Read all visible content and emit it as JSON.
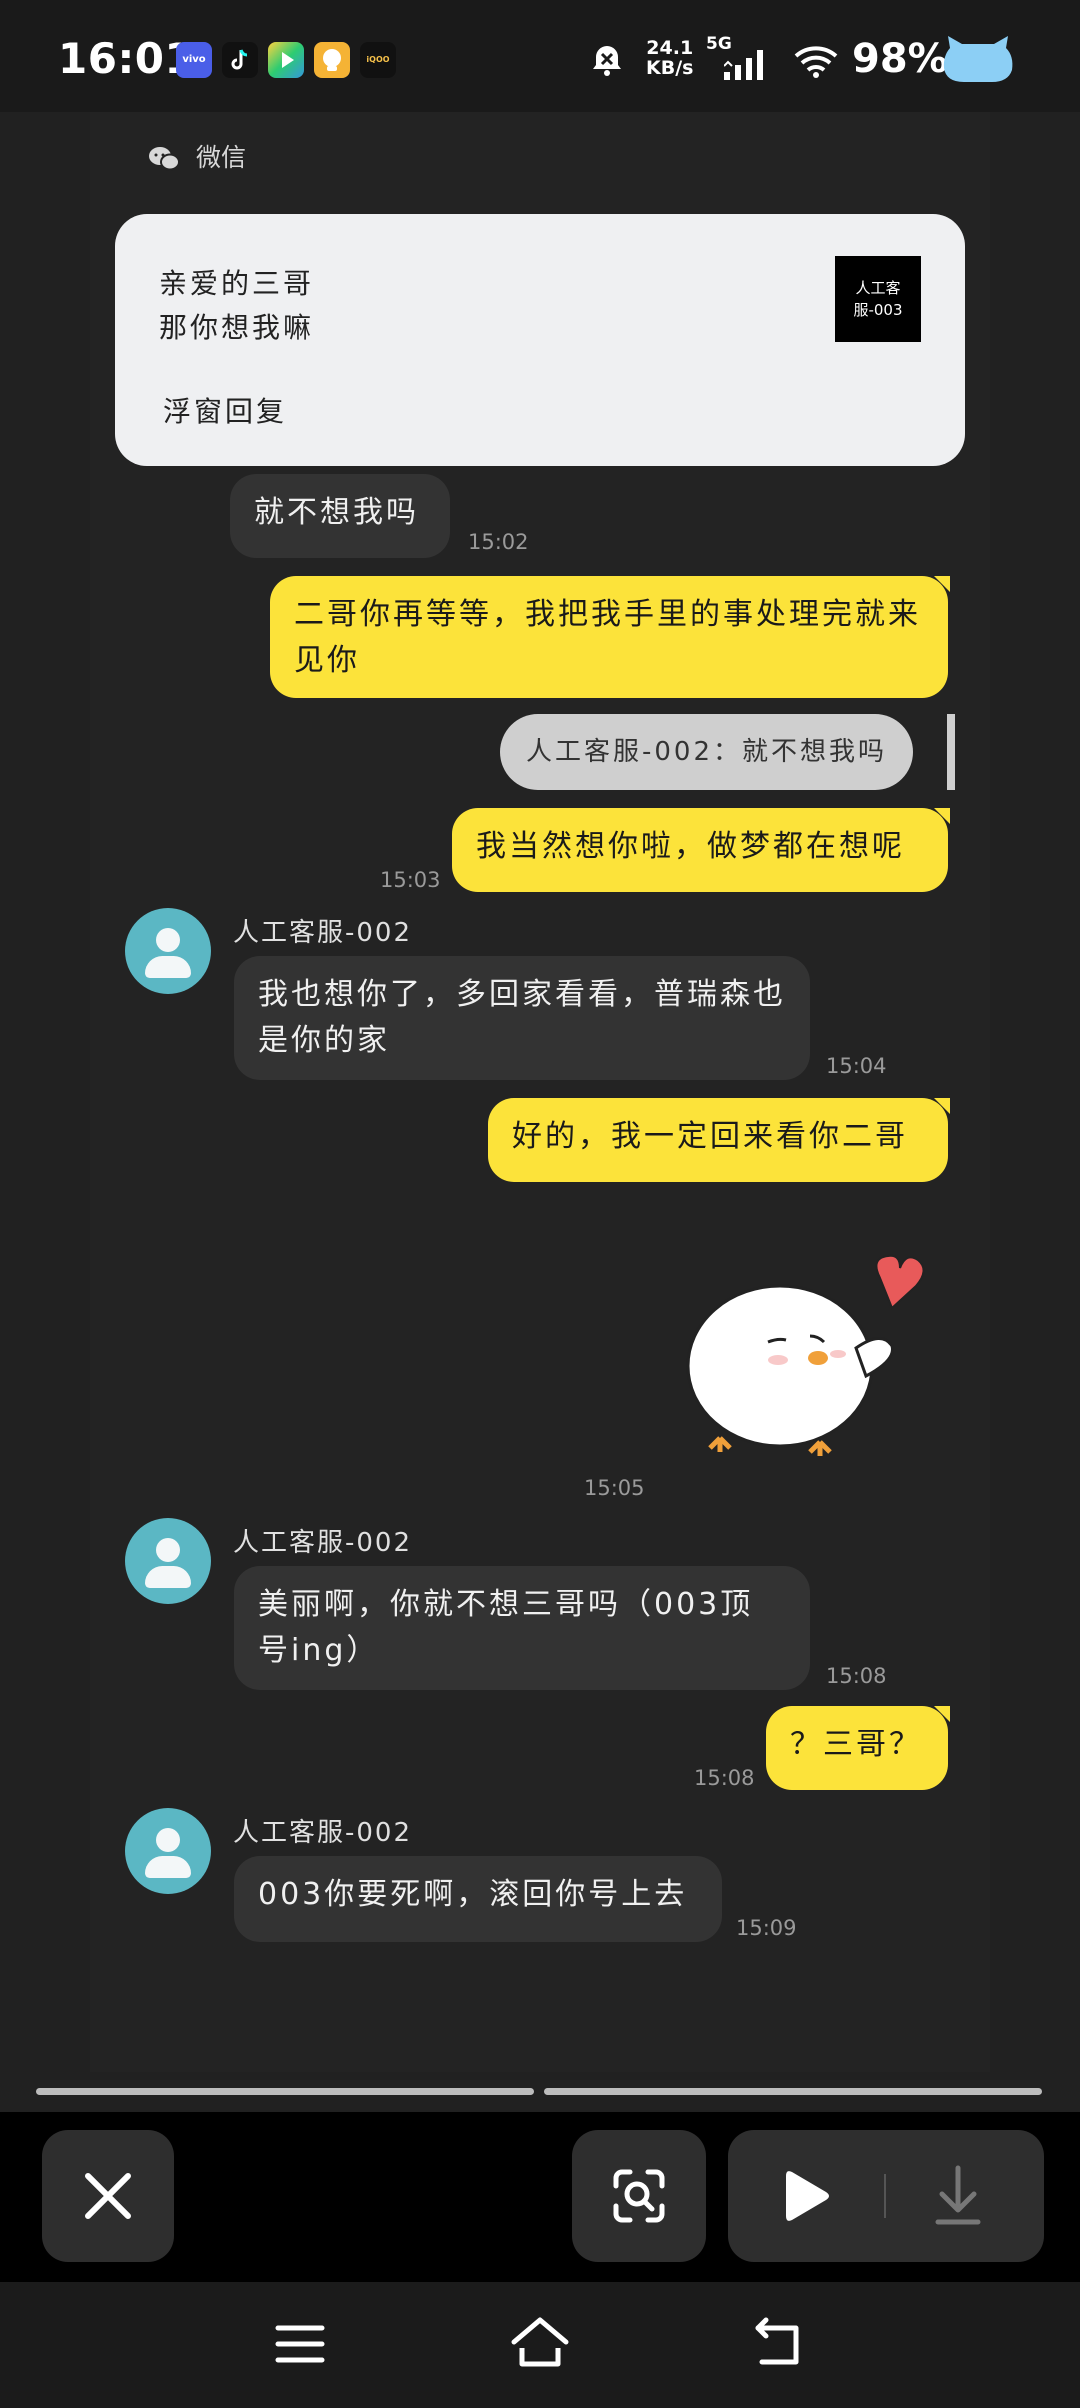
{
  "status_bar": {
    "time": "16:01",
    "app_icons": [
      "vivo-app-icon",
      "tiktok-icon",
      "video-app-icon",
      "toast-app-icon",
      "iqoo-app-icon"
    ],
    "app_icon_labels": {
      "vivo": "vivo",
      "iqoo": "iQOO"
    },
    "net_speed": "24.1",
    "net_unit": "KB/s",
    "network": "5G",
    "battery": "98%"
  },
  "notification": {
    "app_name": "微信",
    "line1": "亲爱的三哥",
    "line2": "那你想我嘛",
    "action": "浮窗回复",
    "thumb_text": "人工客服-003"
  },
  "chat": {
    "messages": [
      {
        "text": "就不想我吗",
        "time": "15:02"
      },
      {
        "text": "二哥你再等等，我把我手里的事处理完就来见你"
      },
      {
        "quote": "人工客服-002：就不想我吗"
      },
      {
        "text": "我当然想你啦，做梦都在想呢",
        "time": "15:03"
      },
      {
        "sender": "人工客服-002",
        "text": "我也想你了，多回家看看，普瑞森也是你的家",
        "time": "15:04"
      },
      {
        "text": "好的，我一定回来看你二哥"
      },
      {
        "sticker": "chick-with-heart-sticker",
        "time": "15:05"
      },
      {
        "sender": "人工客服-002",
        "text": "美丽啊，你就不想三哥吗（003顶号ing）",
        "time": "15:08"
      },
      {
        "text": "？三哥？",
        "time": "15:08"
      },
      {
        "sender": "人工客服-002",
        "text": "003你要死啊，滚回你号上去",
        "time": "15:09"
      }
    ]
  },
  "colors": {
    "bubble_self": "#fce33a",
    "bubble_other": "#333333",
    "avatar": "#5bb7c4"
  }
}
